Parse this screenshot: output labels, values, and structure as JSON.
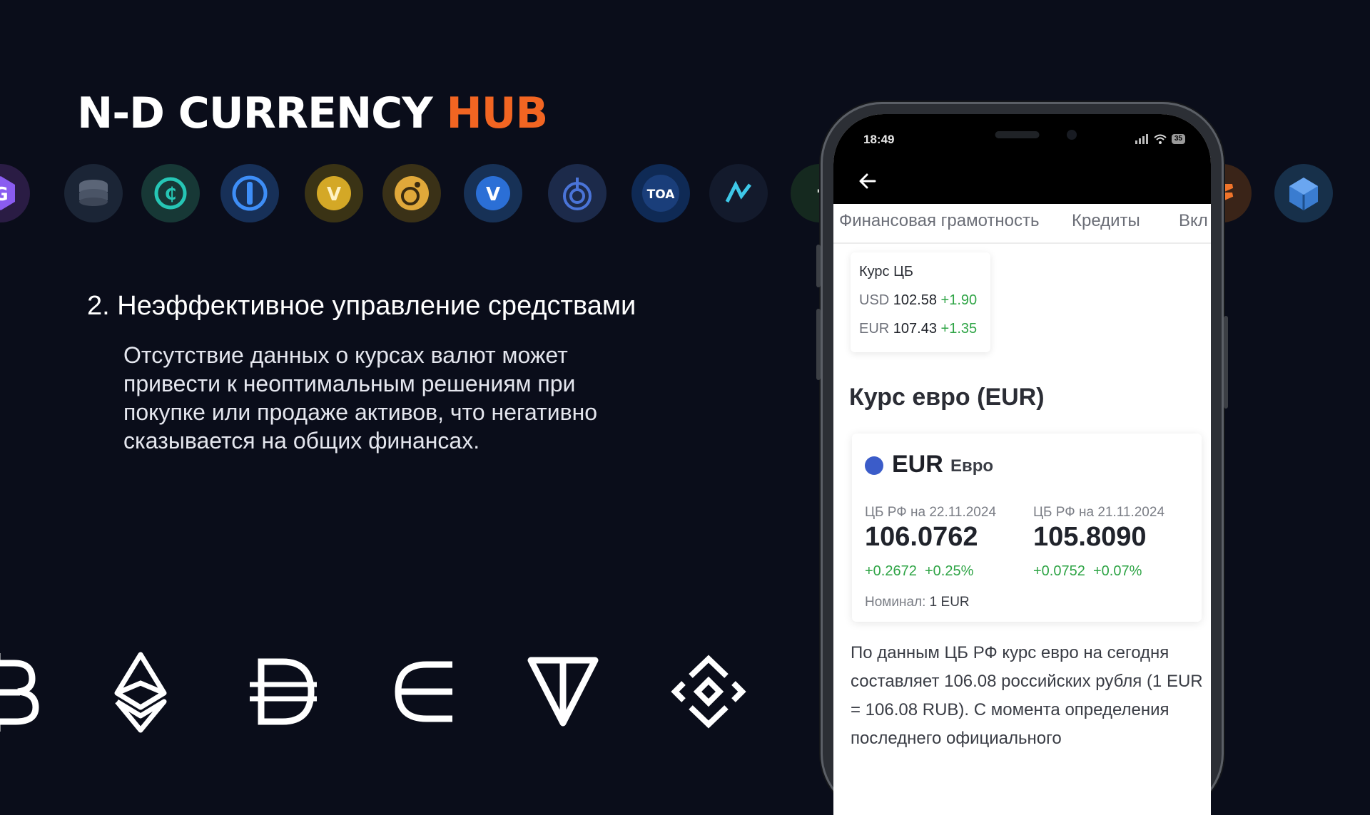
{
  "slide": {
    "title_main": "N-D CURRENCY ",
    "title_accent": "HUB",
    "heading": "2. Неэффективное управление средствами",
    "paragraph": "Отсутствие данных о курсах валют может привести к неоптимальным решениям при покупке или продаже активов, что негативно сказывается на общих финансах."
  },
  "coin_icons": [
    "gravity-coin-icon",
    "database-coin-icon",
    "ccash-coin-icon",
    "iexec-coin-icon",
    "vibe-coin-icon",
    "snail-coin-icon",
    "vchain-coin-icon",
    "target-coin-icon",
    "toa-coin-icon",
    "n7-coin-icon",
    "f-coin-icon",
    "stack-coin-icon",
    "cube-coin-icon"
  ],
  "coin_labels": {
    "toa": "TOA"
  },
  "crypto_icons": [
    "bitcoin-icon",
    "ethereum-icon",
    "dai-icon",
    "element-icon",
    "ton-icon",
    "bnb-icon"
  ],
  "colors": {
    "background": "#0a0d1a",
    "accent": "#f26522",
    "positive": "#2ea445"
  },
  "phone": {
    "status_time": "18:49",
    "battery": "35",
    "tabs": [
      "Финансовая грамотность",
      "Кредиты",
      "Вкл"
    ],
    "rate_card": {
      "title": "Курс ЦБ",
      "rows": [
        {
          "code": "USD",
          "value": "102.58",
          "change": "+1.90"
        },
        {
          "code": "EUR",
          "value": "107.43",
          "change": "+1.35"
        }
      ]
    },
    "euro_heading": "Курс евро (EUR)",
    "eur_card": {
      "code": "EUR",
      "name": "Евро",
      "columns": [
        {
          "label": "ЦБ РФ на 22.11.2024",
          "value": "106.0762",
          "change_abs": "+0.2672",
          "change_pct": "+0.25%"
        },
        {
          "label": "ЦБ РФ на 21.11.2024",
          "value": "105.8090",
          "change_abs": "+0.0752",
          "change_pct": "+0.07%"
        }
      ],
      "nominal_label": "Номинал:",
      "nominal_value": "1 EUR"
    },
    "body_text": "По данным ЦБ РФ курс евро на сегодня составляет 106.08 российских рубля (1 EUR = 106.08 RUB). С момента определения последнего официального"
  }
}
